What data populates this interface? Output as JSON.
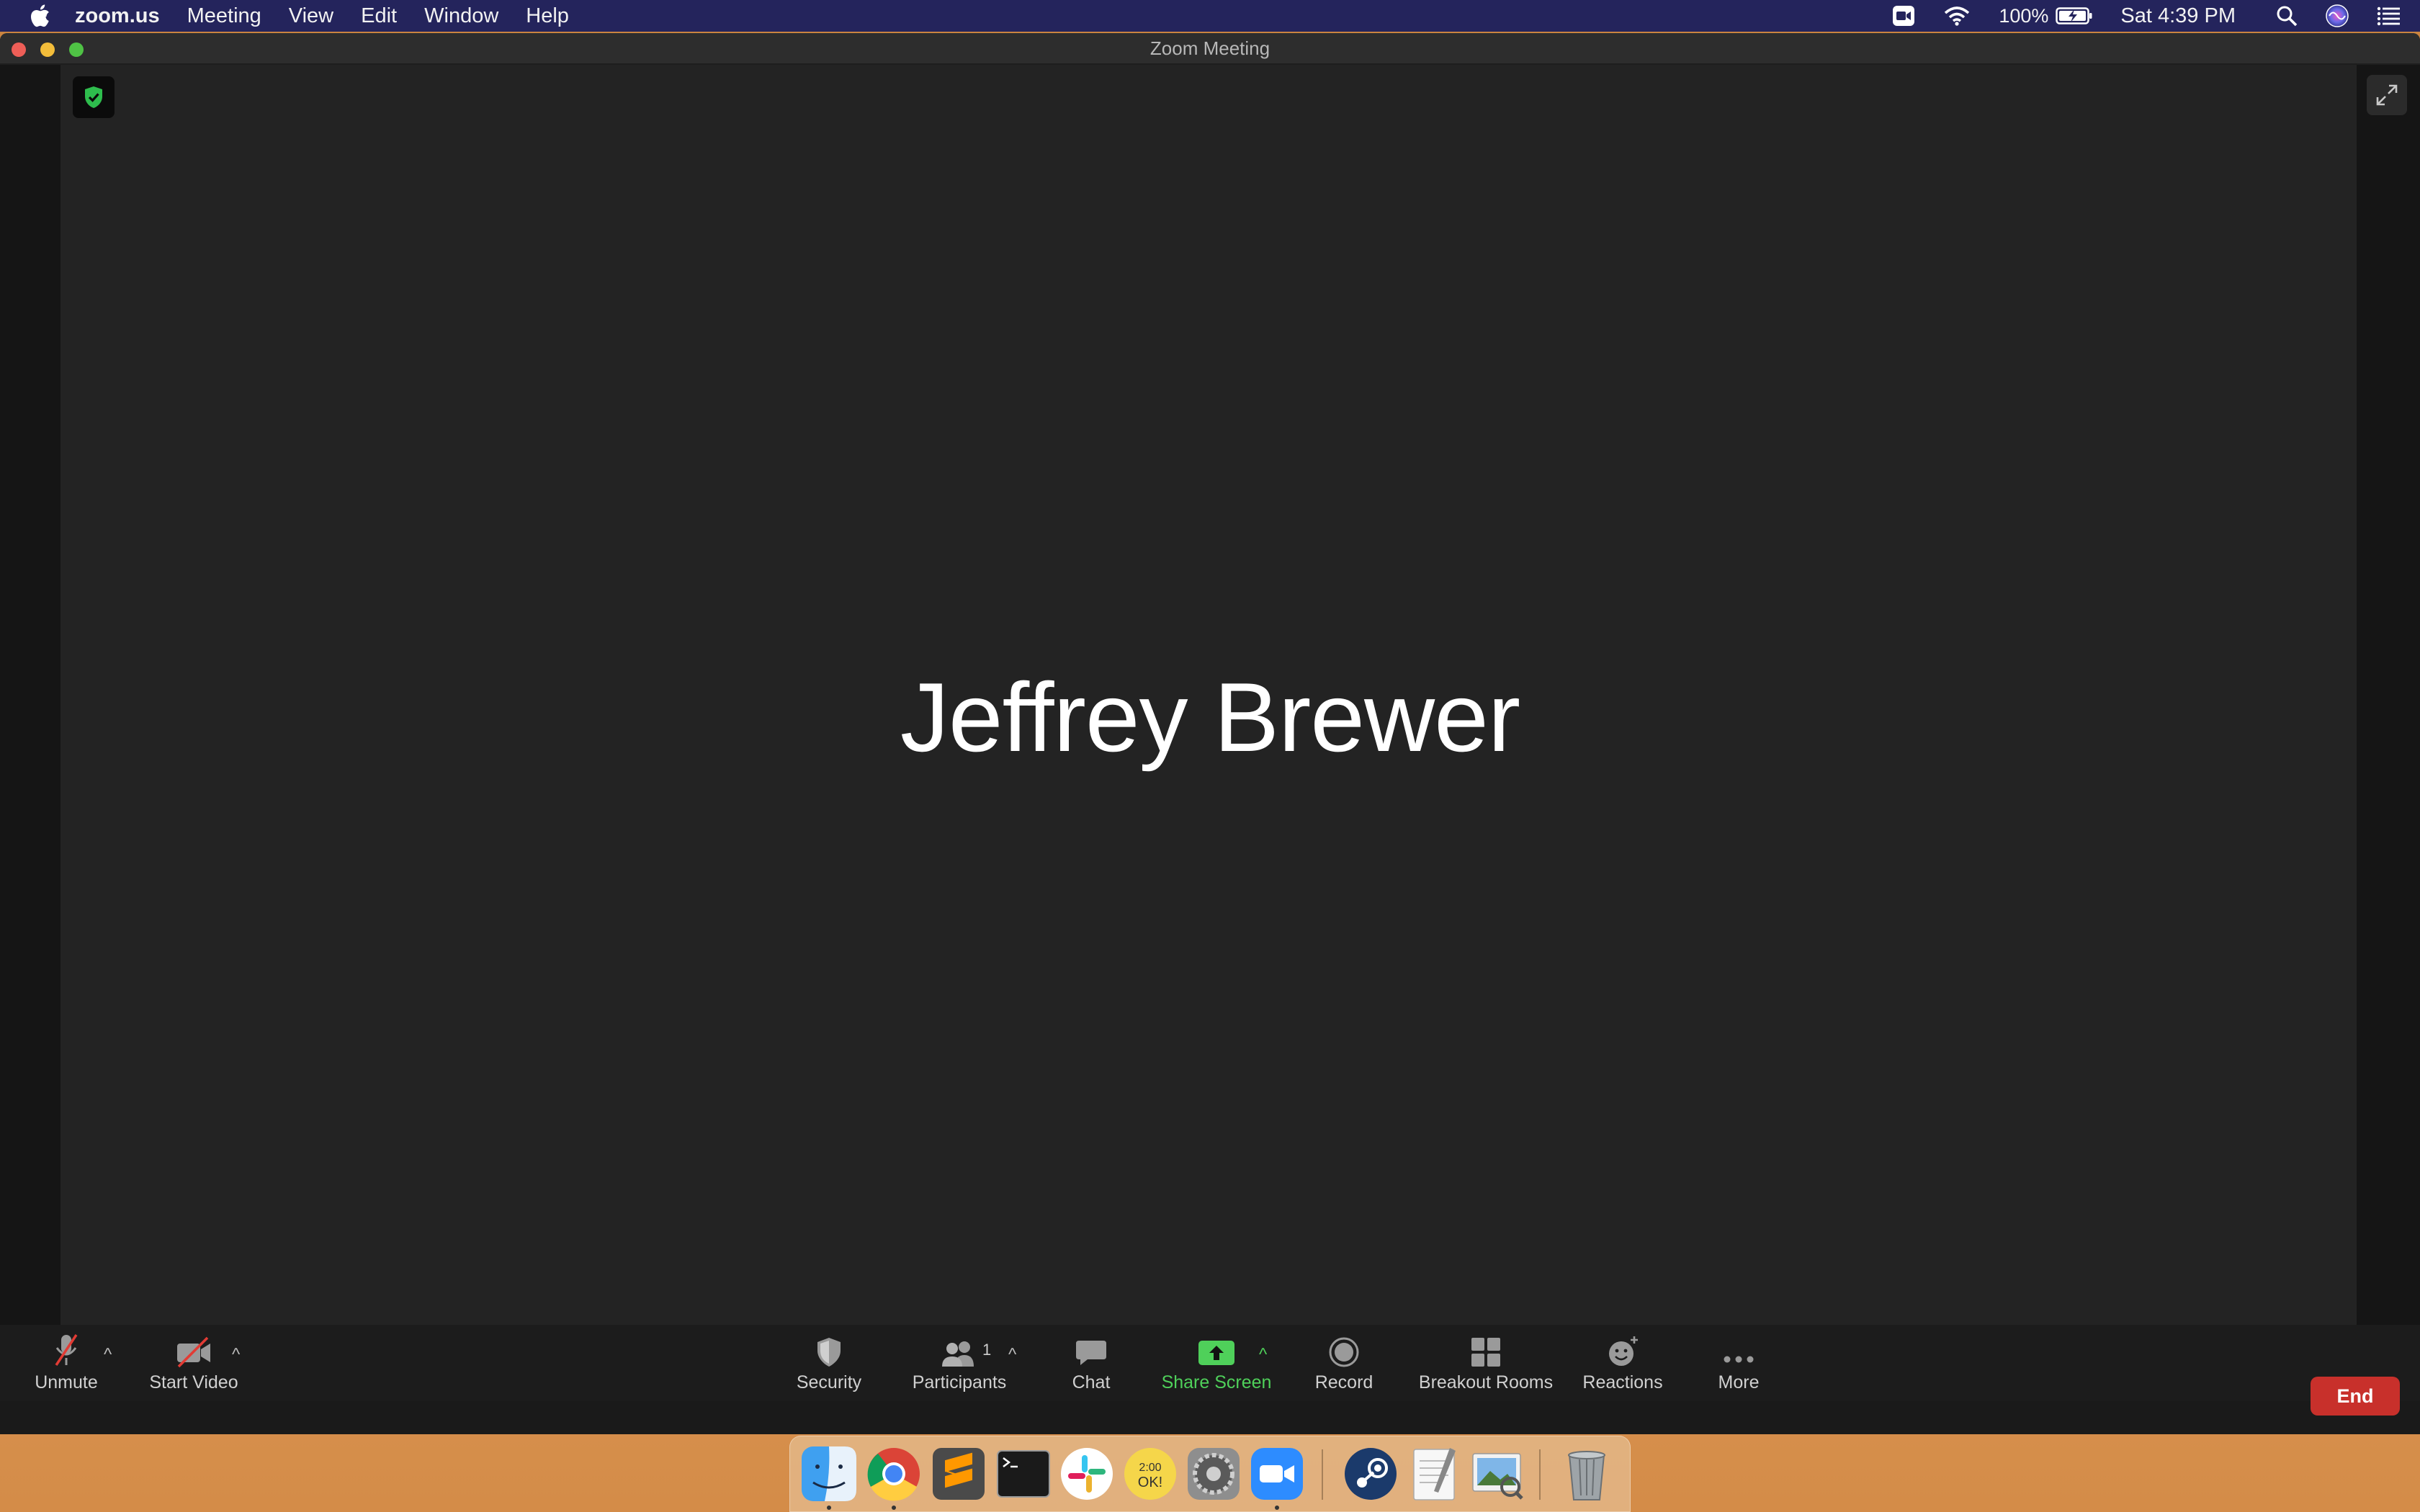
{
  "menubar": {
    "app_name": "zoom.us",
    "items": [
      "Meeting",
      "View",
      "Edit",
      "Window",
      "Help"
    ],
    "battery": "100%",
    "clock": "Sat 4:39 PM"
  },
  "window": {
    "title": "Zoom Meeting"
  },
  "meeting": {
    "participant_name": "Jeffrey Brewer",
    "participant_count": "1"
  },
  "toolbar": {
    "unmute": "Unmute",
    "start_video": "Start Video",
    "security": "Security",
    "participants": "Participants",
    "chat": "Chat",
    "share_screen": "Share Screen",
    "record": "Record",
    "breakout_rooms": "Breakout Rooms",
    "reactions": "Reactions",
    "more": "More",
    "end": "End"
  },
  "colors": {
    "share_green": "#4fd05a",
    "end_red": "#c8302b",
    "menubar": "#24245c"
  },
  "dock": {
    "apps": [
      "Finder",
      "Google Chrome",
      "Sublime Text",
      "Terminal",
      "Slack",
      "Stickies",
      "System Preferences",
      "Zoom",
      "Steam",
      "TextEdit",
      "Preview",
      "Trash"
    ]
  }
}
